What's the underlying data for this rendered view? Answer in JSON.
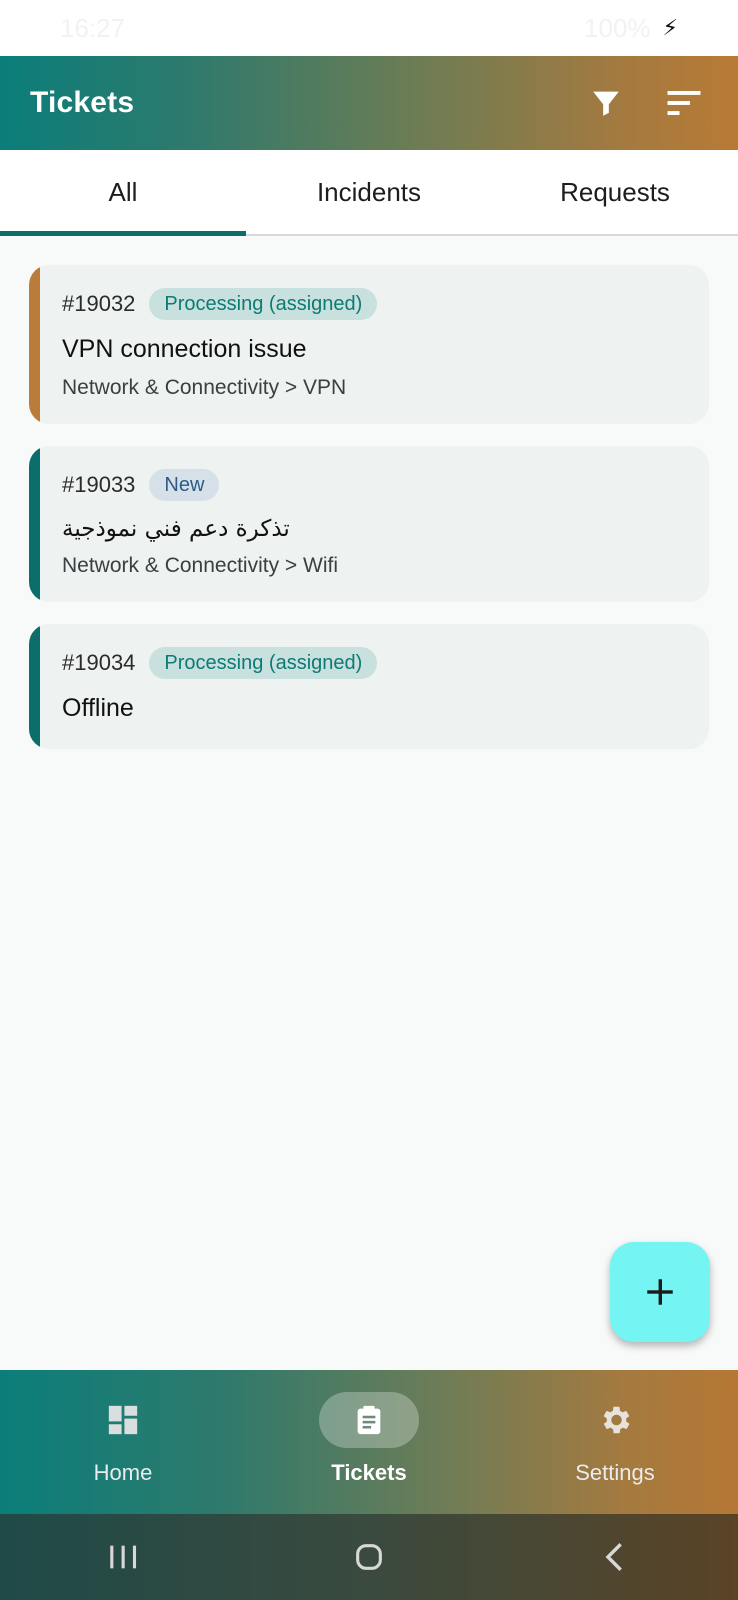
{
  "status_bar": {
    "time": "16:27",
    "battery": "100%"
  },
  "app_bar": {
    "title": "Tickets",
    "filter_icon": "filter-icon",
    "sort_icon": "sort-icon"
  },
  "tabs": [
    {
      "label": "All",
      "active": true
    },
    {
      "label": "Incidents",
      "active": false
    },
    {
      "label": "Requests",
      "active": false
    }
  ],
  "tickets": [
    {
      "id": "#19032",
      "status": "Processing (assigned)",
      "title": "VPN connection issue",
      "category": "Network & Connectivity > VPN",
      "accent": "#b97c3a"
    },
    {
      "id": "#19033",
      "status": "New",
      "title": "تذكرة دعم فني نموذجية",
      "category": "Network & Connectivity > Wifi",
      "accent": "#0c6e6b"
    },
    {
      "id": "#19034",
      "status": "Processing (assigned)",
      "title": "Offline",
      "category": "",
      "accent": "#0c6e6b"
    }
  ],
  "fab": {
    "icon": "plus-icon"
  },
  "bottom_nav": [
    {
      "label": "Home",
      "icon": "dashboard-icon",
      "active": false
    },
    {
      "label": "Tickets",
      "icon": "clipboard-icon",
      "active": true
    },
    {
      "label": "Settings",
      "icon": "gear-icon",
      "active": false
    }
  ],
  "colors": {
    "accent_teal": "#0c6e6b",
    "accent_orange": "#b97c3a",
    "fab": "#74f4f3"
  }
}
